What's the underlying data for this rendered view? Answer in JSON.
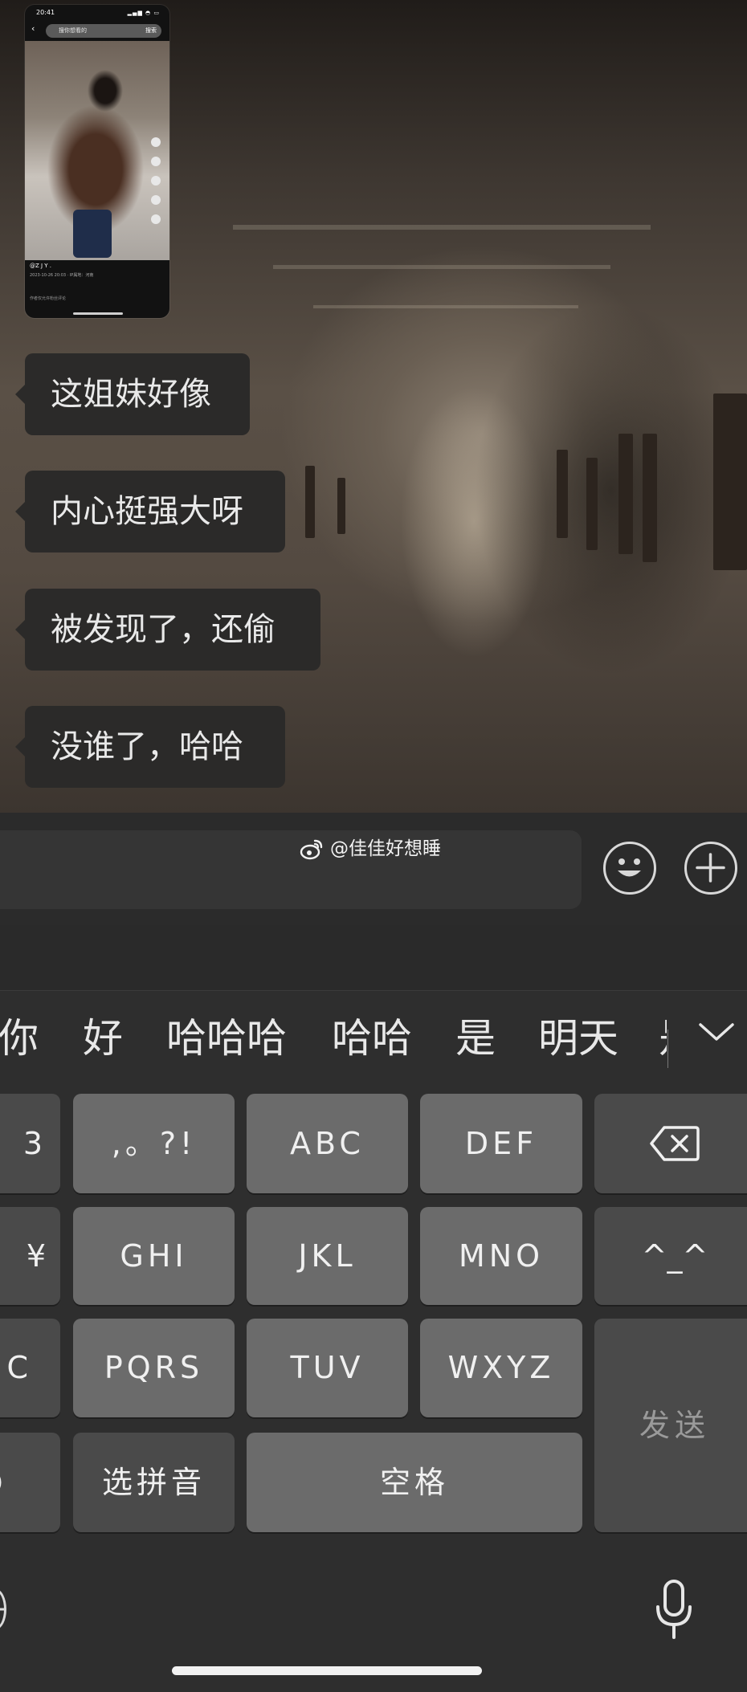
{
  "shared_video": {
    "status_time": "20:41",
    "search_placeholder": "搜你想看的",
    "search_button": "搜索",
    "author": "@Z J Y .",
    "date": "2023-10-26 20:03 · IP属地：河南",
    "comment_hint": "作者仅允许粉丝评论"
  },
  "messages": [
    {
      "text": "这姐妹好像"
    },
    {
      "text": "内心挺强大呀"
    },
    {
      "text": "被发现了，还偷"
    },
    {
      "text": "没谁了，哈哈"
    }
  ],
  "input_bar": {
    "message_value": "",
    "emoji_icon": "emoji-icon",
    "plus_icon": "plus-icon"
  },
  "watermark": {
    "icon": "weibo-icon",
    "text": "@佳佳好想睡"
  },
  "keyboard": {
    "candidates": [
      "你",
      "好",
      "哈哈哈",
      "哈哈",
      "是",
      "明天"
    ],
    "candidate_cut": "是",
    "keys": {
      "left_row1": "3",
      "left_row2": "¥",
      "left_row3": "C",
      "left_row4": "",
      "punct": ",。?!",
      "abc": "ABC",
      "def": "DEF",
      "ghi": "GHI",
      "jkl": "JKL",
      "mno": "MNO",
      "emoticon": "^_^",
      "pqrs": "PQRS",
      "tuv": "TUV",
      "wxyz": "WXYZ",
      "send": "发送",
      "pinyin": "选拼音",
      "space": "空格"
    },
    "icons": [
      "delete-icon",
      "chevron-down-icon",
      "globe-icon",
      "microphone-icon"
    ]
  },
  "colors": {
    "bubble": "#2b2a29",
    "bubble_text": "#e9e9e9",
    "key": "#6b6b6b",
    "function_key": "#4a4a4a",
    "keyboard_bg": "#2e2e2e"
  }
}
